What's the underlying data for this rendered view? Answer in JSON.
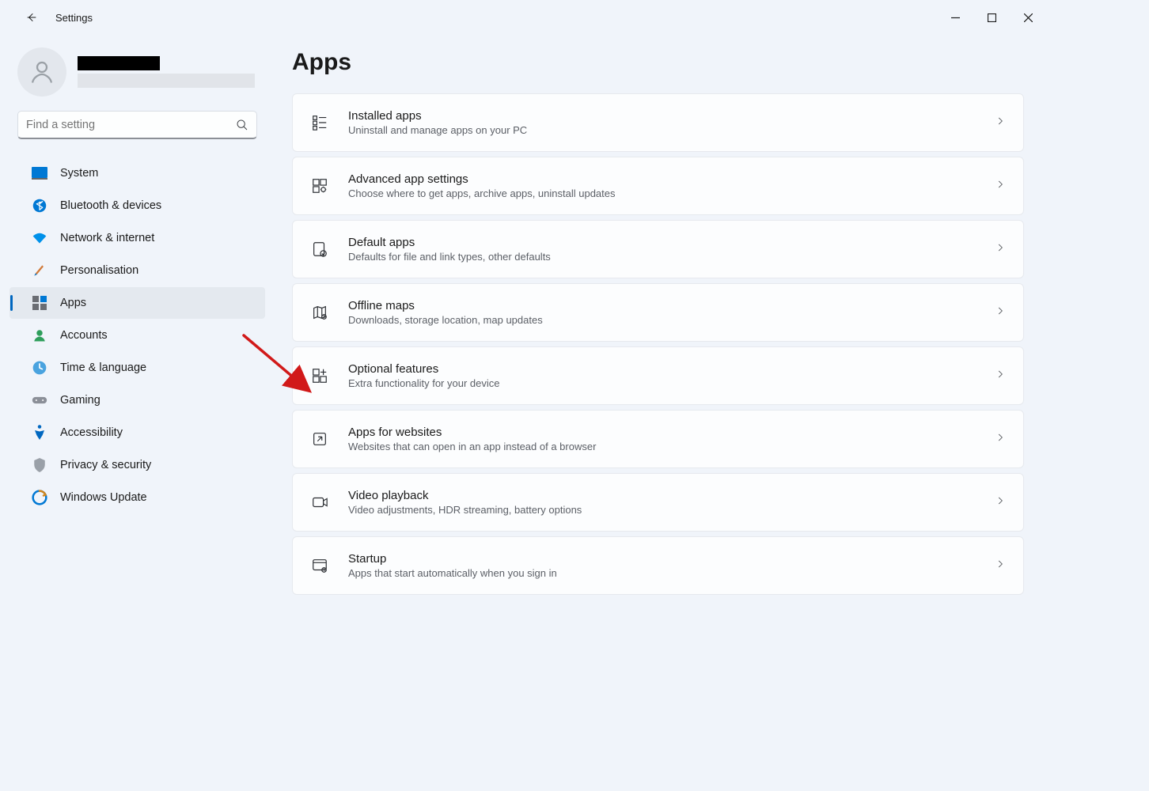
{
  "app_title": "Settings",
  "search": {
    "placeholder": "Find a setting"
  },
  "nav": {
    "items": [
      {
        "label": "System"
      },
      {
        "label": "Bluetooth & devices"
      },
      {
        "label": "Network & internet"
      },
      {
        "label": "Personalisation"
      },
      {
        "label": "Apps"
      },
      {
        "label": "Accounts"
      },
      {
        "label": "Time & language"
      },
      {
        "label": "Gaming"
      },
      {
        "label": "Accessibility"
      },
      {
        "label": "Privacy & security"
      },
      {
        "label": "Windows Update"
      }
    ],
    "active_index": 4
  },
  "page": {
    "title": "Apps",
    "cards": [
      {
        "title": "Installed apps",
        "sub": "Uninstall and manage apps on your PC"
      },
      {
        "title": "Advanced app settings",
        "sub": "Choose where to get apps, archive apps, uninstall updates"
      },
      {
        "title": "Default apps",
        "sub": "Defaults for file and link types, other defaults"
      },
      {
        "title": "Offline maps",
        "sub": "Downloads, storage location, map updates"
      },
      {
        "title": "Optional features",
        "sub": "Extra functionality for your device"
      },
      {
        "title": "Apps for websites",
        "sub": "Websites that can open in an app instead of a browser"
      },
      {
        "title": "Video playback",
        "sub": "Video adjustments, HDR streaming, battery options"
      },
      {
        "title": "Startup",
        "sub": "Apps that start automatically when you sign in"
      }
    ]
  },
  "annotation": {
    "points_to_card_index": 4
  }
}
